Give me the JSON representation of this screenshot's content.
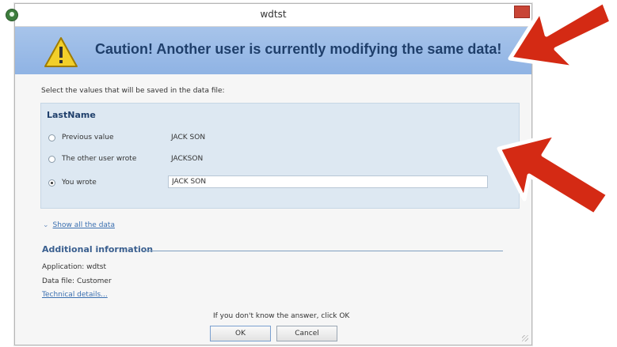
{
  "window": {
    "title": "wdtst"
  },
  "banner": {
    "message": "Caution! Another user is currently modifying the same data!"
  },
  "instruction": "Select the values that will be saved in the data file:",
  "field": {
    "name": "LastName",
    "options": [
      {
        "label": "Previous value",
        "value": "JACK SON",
        "selected": false
      },
      {
        "label": "The other user wrote",
        "value": "JACKSON",
        "selected": false
      },
      {
        "label": "You wrote",
        "value": "JACK SON",
        "selected": true
      }
    ]
  },
  "show_all_label": "Show all the data",
  "additional": {
    "heading": "Additional information",
    "application": "Application: wdtst",
    "data_file": "Data file: Customer",
    "technical_link": "Technical details..."
  },
  "footer": {
    "hint": "If you don't know the answer, click OK",
    "ok_label": "OK",
    "cancel_label": "Cancel"
  },
  "colors": {
    "banner": "#9bbce7",
    "panel": "#dde8f2",
    "arrow": "#d42a14"
  },
  "icons": {
    "banner": "warning-triangle-icon",
    "annotation": "red-arrow-icon"
  }
}
